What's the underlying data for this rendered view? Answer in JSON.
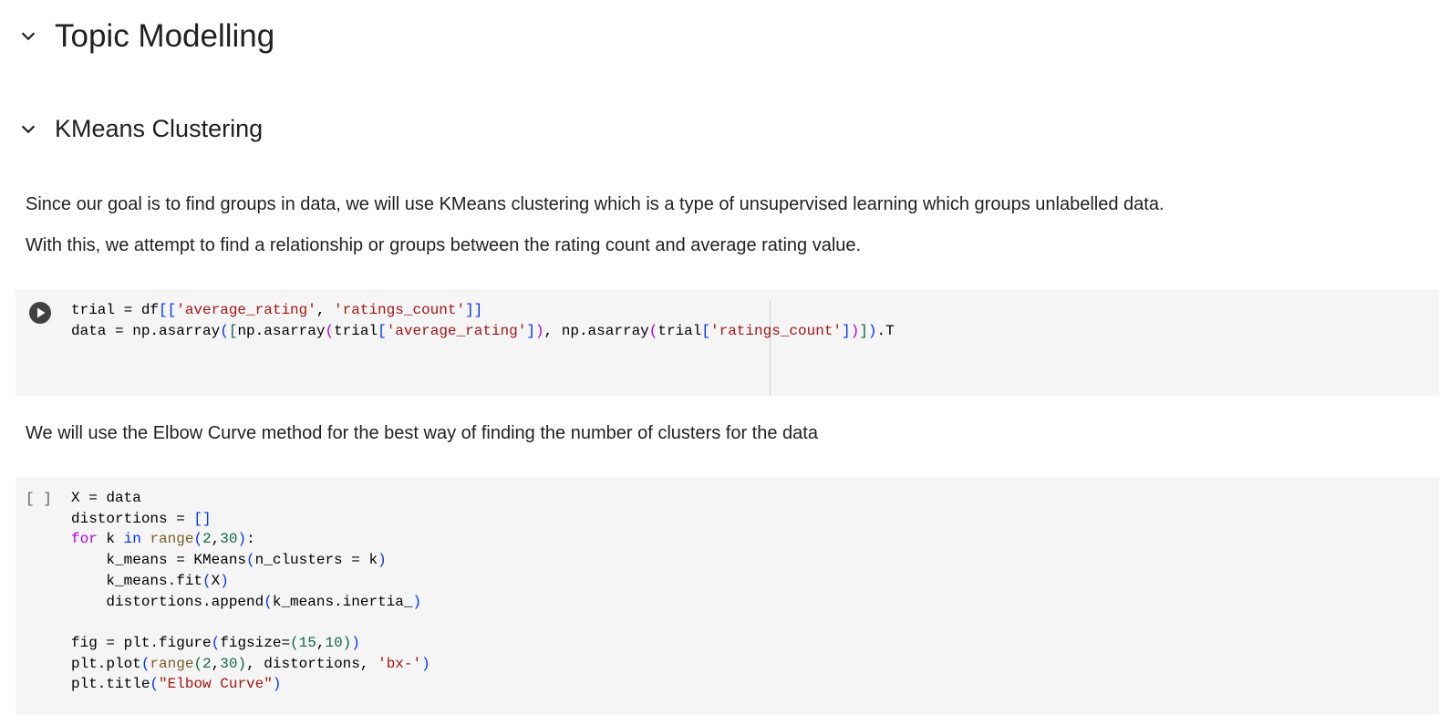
{
  "headings": {
    "h1": "Topic Modelling",
    "h2": "KMeans Clustering"
  },
  "paragraphs": {
    "p1": "Since our goal is to find groups in data, we will use KMeans clustering which is a type of unsupervised learning which groups unlabelled data.",
    "p2": "With this, we attempt to find a relationship or groups between the rating count and average rating value.",
    "p3": "We will use the Elbow Curve method for the best way of finding the number of clusters for the data"
  },
  "cell2": {
    "exec_count": "[ ]"
  },
  "icons": {
    "collapse": "chevron-down-icon",
    "run": "play-circle-icon"
  },
  "colors": {
    "cell_bg": "#f5f5f5",
    "keyword": "#af00db",
    "string": "#a31515",
    "number": "#116644",
    "bracket": "#0431fa",
    "builtin": "#795e26"
  }
}
